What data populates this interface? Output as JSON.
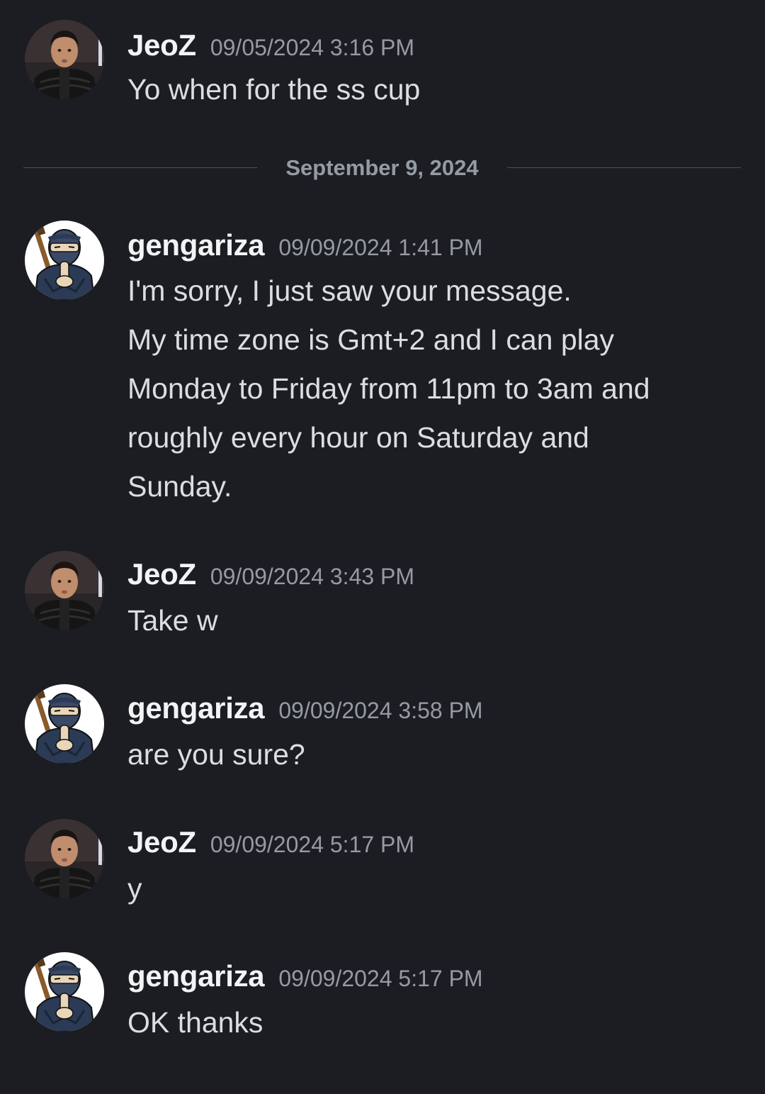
{
  "messages": [
    {
      "username": "JeoZ",
      "timestamp": "09/05/2024 3:16 PM",
      "avatar": "photo-avatar",
      "lines": [
        "Yo when for the ss cup"
      ]
    },
    {
      "username": "gengariza",
      "timestamp": "09/09/2024 1:41 PM",
      "avatar": "ninja-avatar",
      "lines": [
        "I'm sorry, I just saw your message.",
        "My time zone is Gmt+2 and I can play",
        "Monday to Friday from 11pm to 3am and",
        "roughly every hour on Saturday and",
        "Sunday."
      ]
    },
    {
      "username": "JeoZ",
      "timestamp": "09/09/2024 3:43 PM",
      "avatar": "photo-avatar",
      "lines": [
        "Take w"
      ]
    },
    {
      "username": "gengariza",
      "timestamp": "09/09/2024 3:58 PM",
      "avatar": "ninja-avatar",
      "lines": [
        "are you sure?"
      ]
    },
    {
      "username": "JeoZ",
      "timestamp": "09/09/2024 5:17 PM",
      "avatar": "photo-avatar",
      "lines": [
        "y"
      ]
    },
    {
      "username": "gengariza",
      "timestamp": "09/09/2024 5:17 PM",
      "avatar": "ninja-avatar",
      "lines": [
        "OK thanks"
      ]
    }
  ],
  "date_divider": "September 9, 2024",
  "colors": {
    "background": "#1c1d22",
    "username": "#f2f3f5",
    "timestamp": "#949ba4",
    "text": "#dbdee1",
    "divider": "#4e5058"
  }
}
